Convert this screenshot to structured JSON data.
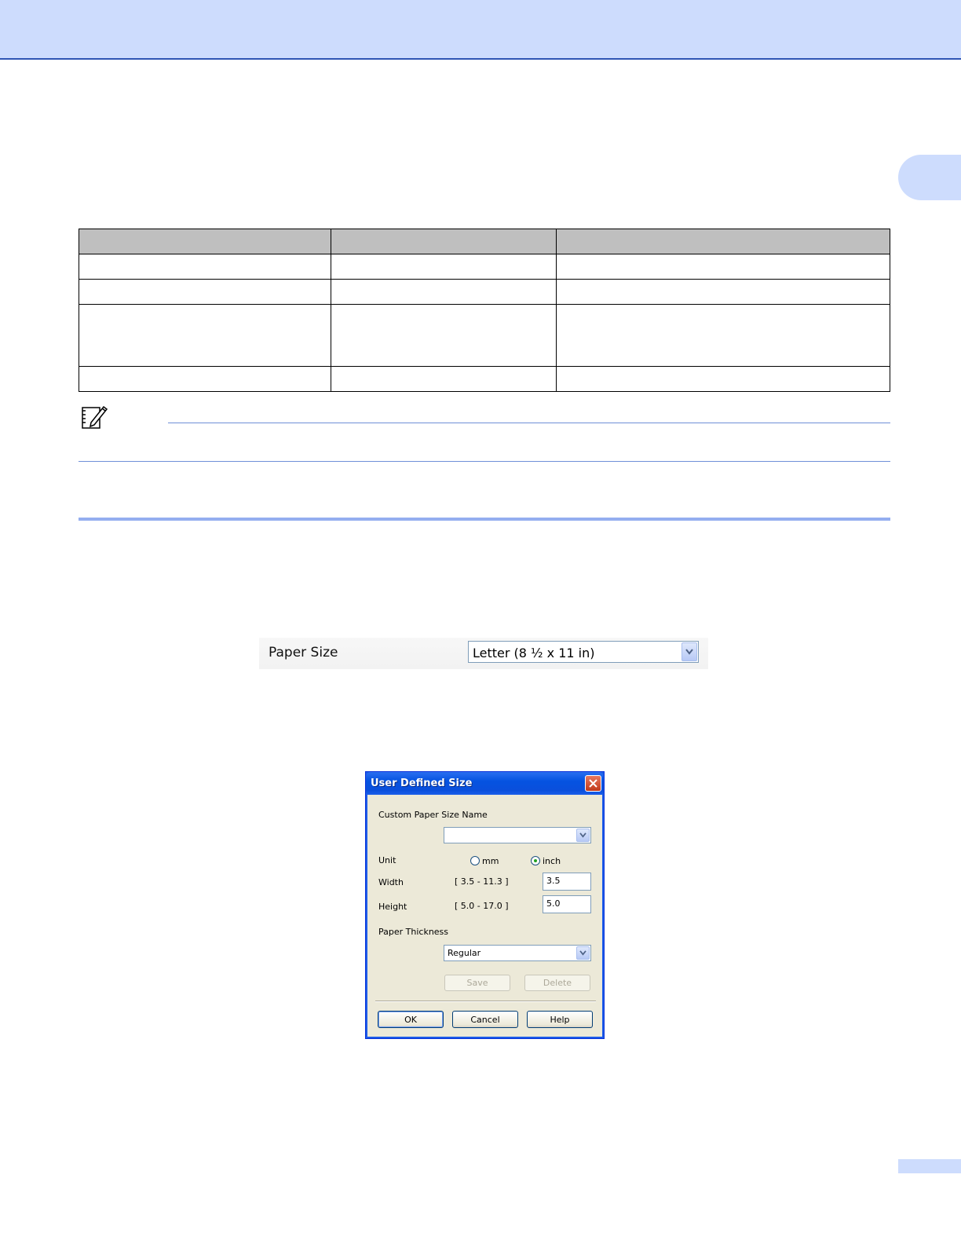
{
  "dialog": {
    "title": "User Defined Size",
    "custom_name_label": "Custom Paper Size Name",
    "custom_name_value": "",
    "unit_label": "Unit",
    "unit_mm": "mm",
    "unit_inch": "inch",
    "unit_selected": "inch",
    "width_label": "Width",
    "width_range": "[ 3.5 - 11.3 ]",
    "width_value": "3.5",
    "height_label": "Height",
    "height_range": "[ 5.0 - 17.0 ]",
    "height_value": "5.0",
    "thickness_label": "Paper Thickness",
    "thickness_value": "Regular",
    "save_label": "Save",
    "delete_label": "Delete",
    "ok_label": "OK",
    "cancel_label": "Cancel",
    "help_label": "Help"
  },
  "paper_size": {
    "label": "Paper Size",
    "value": "Letter (8 ½ x 11 in)"
  },
  "icons": {
    "note": "note-pencil-icon",
    "dropdown": "chevron-down-icon",
    "close": "close-icon"
  },
  "colors": {
    "header_band": "#cddcfd",
    "rule": "#94aef0",
    "xp_title": "#0553e1"
  }
}
